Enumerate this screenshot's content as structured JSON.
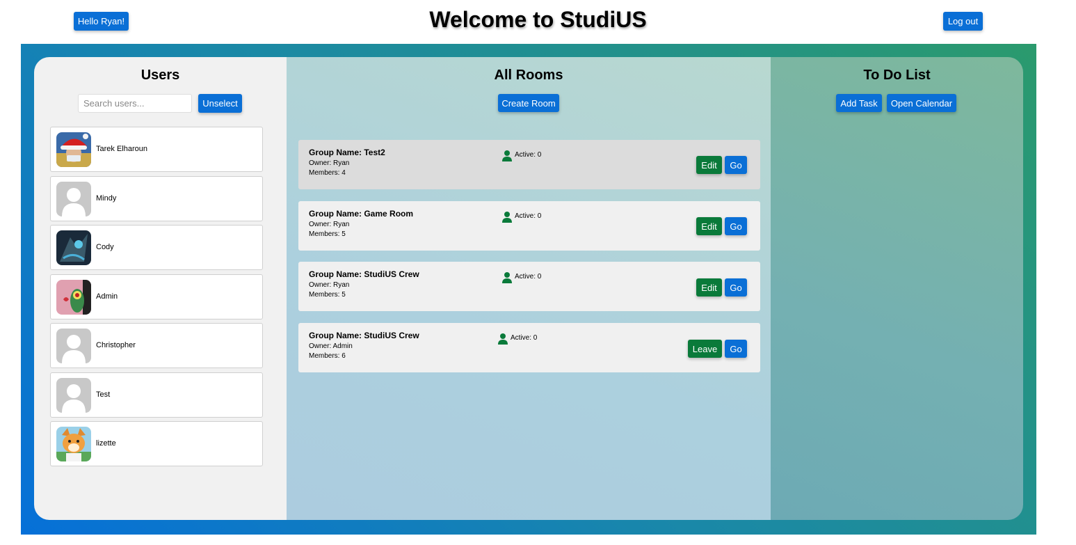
{
  "header": {
    "title": "Welcome to StudiUS",
    "greeting_label": "Hello Ryan!",
    "logout_label": "Log out"
  },
  "users_panel": {
    "title": "Users",
    "search_placeholder": "Search users...",
    "unselect_label": "Unselect",
    "users": [
      {
        "name": "Tarek Elharoun",
        "avatar": "santa-hat-photo"
      },
      {
        "name": "Mindy",
        "avatar": "default-person"
      },
      {
        "name": "Cody",
        "avatar": "game-character-art"
      },
      {
        "name": "Admin",
        "avatar": "cartoon-plankton"
      },
      {
        "name": "Christopher",
        "avatar": "default-person"
      },
      {
        "name": "Test",
        "avatar": "default-person"
      },
      {
        "name": "lizette",
        "avatar": "cartoon-dog"
      }
    ]
  },
  "rooms_panel": {
    "title": "All Rooms",
    "create_label": "Create Room",
    "rooms": [
      {
        "name": "Group Name: Test2",
        "owner": "Owner: Ryan",
        "members": "Members: 4",
        "active": "Active: 0",
        "action_label": "Edit",
        "go_label": "Go",
        "highlighted": true
      },
      {
        "name": "Group Name: Game Room",
        "owner": "Owner: Ryan",
        "members": "Members: 5",
        "active": "Active: 0",
        "action_label": "Edit",
        "go_label": "Go",
        "highlighted": false
      },
      {
        "name": "Group Name: StudiUS Crew",
        "owner": "Owner: Ryan",
        "members": "Members: 5",
        "active": "Active: 0",
        "action_label": "Edit",
        "go_label": "Go",
        "highlighted": false
      },
      {
        "name": "Group Name: StudiUS Crew",
        "owner": "Owner: Admin",
        "members": "Members: 6",
        "active": "Active: 0",
        "action_label": "Leave",
        "go_label": "Go",
        "highlighted": false
      }
    ]
  },
  "todo_panel": {
    "title": "To Do List",
    "add_task_label": "Add Task",
    "calendar_label": "Open Calendar"
  },
  "colors": {
    "primary_button": "#0a6fd6",
    "edit_button": "#0a7a3a",
    "active_icon": "#0a7a3a"
  }
}
